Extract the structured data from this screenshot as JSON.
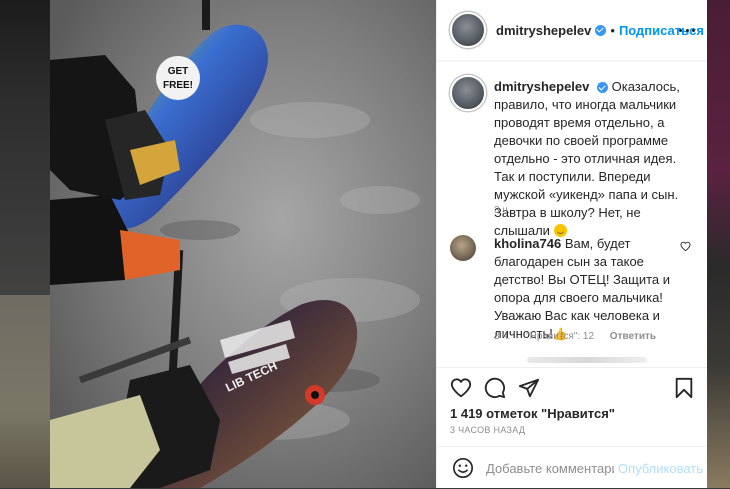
{
  "post": {
    "username": "dmitryshepelev",
    "follow_label": "Подписаться",
    "separator": "•",
    "caption_text": "Оказалось, правило, что иногда мальчики проводят время отдельно, а девочки по своей программе отдельно - это отличная идея. Так и поступили. Впереди мужской «уикенд» папа и сын. Завтра в школу? Нет, не слышали",
    "caption_time": "3 ч.",
    "verified": true
  },
  "photo": {
    "sticker_text_line1": "GET",
    "sticker_text_line2": "FREE!",
    "board_brand": "LIB TECH"
  },
  "comments": [
    {
      "username": "kholina746",
      "text": "Вам, будет благодарен сын за такое детство! Вы ОТЕЦ! Защита и опора для своего мальчика! Уважаю Вас как человека и личность!",
      "emoji": "👍",
      "time": "3 ч.",
      "likes": "\"Нравится\": 12",
      "reply_label": "Ответить"
    }
  ],
  "actions": {
    "likes_text": "1 419 отметок \"Нравится\"",
    "post_time": "3 ЧАСОВ НАЗАД",
    "comment_placeholder": "Добавьте комментарий...",
    "publish_label": "Опубликовать"
  },
  "icons": [
    "heart-icon",
    "comment-icon",
    "share-icon",
    "bookmark-icon",
    "emoji-icon",
    "more-icon",
    "verified-icon"
  ],
  "colors": {
    "accent": "#0095f6",
    "verified": "#3897f0",
    "text": "#262626",
    "muted": "#8e8e8e",
    "publish_disabled": "#b2dffc"
  }
}
